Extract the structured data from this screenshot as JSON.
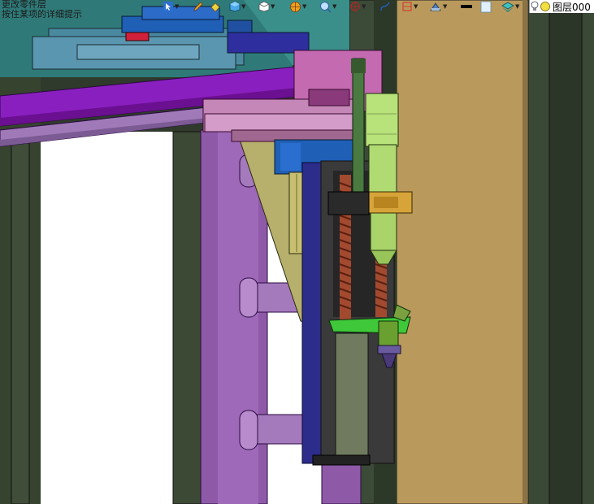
{
  "status": {
    "line1": "更改零件层",
    "line2": "按住某项的详细提示"
  },
  "layer": {
    "name": "图层000"
  },
  "icons": [
    "select-arrow-icon",
    "rotate-view-icon",
    "pencil-icon",
    "pan-icon",
    "cube-view-icon",
    "wire-cube-icon",
    "sun-render-icon",
    "zoom-globe-icon",
    "target-icon",
    "curve-icon",
    "plane-icon",
    "measure-icon",
    "line-color-icon",
    "material-icon",
    "layer-stack-icon",
    "lightbulb-icon",
    "layer-dot-icon"
  ],
  "colors": {
    "bg_green": "#3c4a38",
    "beam_purple": "#8a1fc0",
    "frame_purple": "#8e5aa8",
    "tan_panel": "#b99a5c",
    "blue_block": "#1f5fb5",
    "lime": "#b8e27a",
    "gold": "#d7a43a"
  }
}
